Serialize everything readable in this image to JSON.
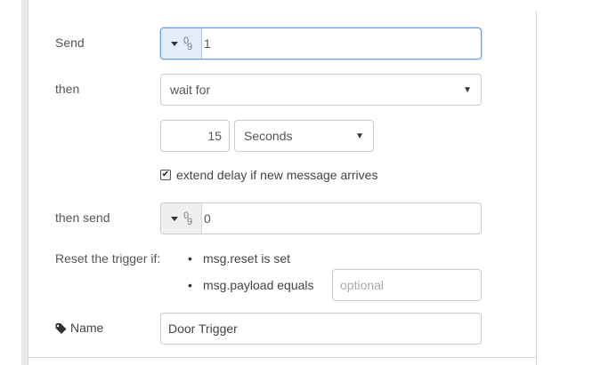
{
  "form": {
    "send": {
      "label": "Send",
      "value": "1",
      "type_icon": "number-type-icon"
    },
    "then": {
      "label": "then",
      "selected": "wait for"
    },
    "duration": {
      "value": "15",
      "unit": "Seconds"
    },
    "extend": {
      "label": "extend delay if new message arrives",
      "checked": true
    },
    "then_send": {
      "label": "then send",
      "value": "0",
      "type_icon": "number-type-icon"
    },
    "reset": {
      "label": "Reset the trigger if:",
      "cond1": "msg.reset is set",
      "cond2": "msg.payload equals",
      "cond2_placeholder": "optional"
    },
    "name": {
      "label": "Name",
      "value": "Door Trigger",
      "icon": "tag-icon"
    }
  },
  "glyphs": {
    "bullet": "•",
    "check": "✔",
    "arrow": "▼",
    "num_top": "0",
    "num_bottom": "9"
  }
}
